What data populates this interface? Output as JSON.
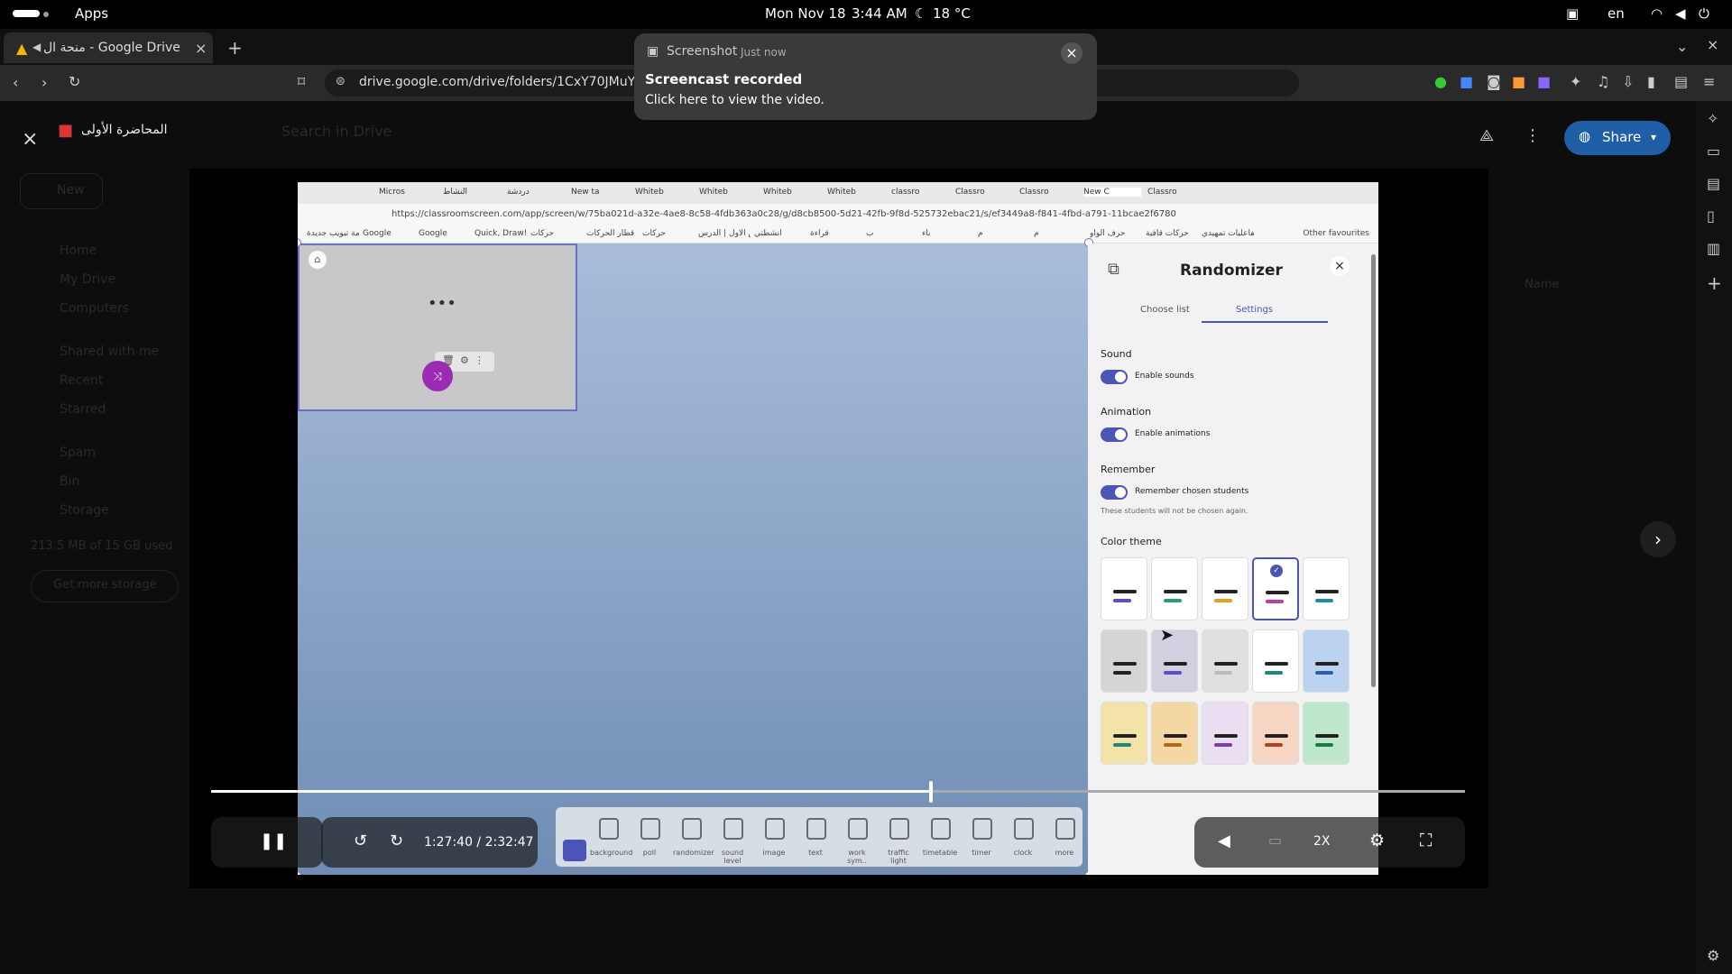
{
  "system_bar": {
    "activities": "Apps",
    "date": "Mon Nov 18",
    "time": "3:44 AM",
    "weather": "18 °C",
    "lang": "en"
  },
  "browser": {
    "tab_title": "منحة ال - Google Drive",
    "url": "drive.google.com/drive/folders/1CxY70JMuYZSLl"
  },
  "notification": {
    "app": "Screenshot",
    "when": "Just now",
    "title": "Screencast recorded",
    "body": "Click here to view the video."
  },
  "drive": {
    "file_title": "المحاضرة الأولى",
    "search_placeholder": "Search in Drive",
    "share_label": "Share",
    "new_label": "New",
    "sidebar": [
      "Home",
      "My Drive",
      "Computers",
      "Shared with me",
      "Recent",
      "Starred",
      "Spam",
      "Bin",
      "Storage"
    ],
    "storage_text": "213.5 MB of 15 GB used",
    "get_storage": "Get more storage",
    "sort_label": "Name"
  },
  "video": {
    "time": "1:27:40 / 2:32:47",
    "progress": 0.573,
    "speed": "2X",
    "inner_browser": {
      "tabs": [
        "Micros",
        "النشاط",
        "دردشة",
        "New ta",
        "Whiteb",
        "Whiteb",
        "Whiteb",
        "Whiteb",
        "classro",
        "Classro",
        "Classro",
        "New C",
        "Classro"
      ],
      "url": "https://classroomscreen.com/app/screen/w/75ba021d-a32e-4ae8-8c58-4fdb363a0c28/g/d8cb8500-5d21-42fb-9f8d-525732ebac21/s/ef3449a8-f841-4fbd-a791-11bcae2f6780",
      "bookmarks": [
        "علامة تبويب جديدة",
        "Google",
        "Google",
        "Quick, Draw!",
        "حركات",
        "قطار الحركات",
        "حركات",
        "التمرين الأول | الدرس...",
        "أنشطتي",
        "قراءة",
        "ب",
        "باء",
        "م",
        "م",
        "حرف الواو",
        "حركات قافية",
        "تفاعليات تمهيدي"
      ],
      "other_favourites": "Other favourites"
    },
    "randomizer": {
      "title": "Randomizer",
      "tab_choose": "Choose list",
      "tab_settings": "Settings",
      "sound_heading": "Sound",
      "sound_toggle": "Enable sounds",
      "animation_heading": "Animation",
      "animation_toggle": "Enable animations",
      "remember_heading": "Remember",
      "remember_toggle": "Remember chosen students",
      "remember_note": "These students will not be chosen again.",
      "color_heading": "Color theme",
      "swatches": [
        [
          "#ffffff",
          "#5c4fc4"
        ],
        [
          "#ffffff",
          "#27a06a"
        ],
        [
          "#ffffff",
          "#e0a21c"
        ],
        [
          "#ffffff",
          "#c03bb3"
        ],
        [
          "#ffffff",
          "#1b8fa8"
        ],
        [
          "#d5d5d5",
          "#222222"
        ],
        [
          "#d0d0e0",
          "#5c4fc4"
        ],
        [
          "#e0e0e0",
          "#bbbbbb"
        ],
        [
          "#ffffff",
          "#1a8b7a"
        ],
        [
          "#bcd3f0",
          "#2b5db0"
        ],
        [
          "#f4e3a8",
          "#1a8b7a"
        ],
        [
          "#f4d7a3",
          "#b5661e"
        ],
        [
          "#eadff2",
          "#7a3fb0"
        ],
        [
          "#f6d6c3",
          "#b5421e"
        ],
        [
          "#bfe7cc",
          "#1c7c45"
        ]
      ],
      "selected_swatch": 3
    },
    "tools": [
      "background",
      "poll",
      "randomizer",
      "sound level",
      "image",
      "text",
      "work sym..",
      "traffic light",
      "timetable",
      "timer",
      "clock",
      "more"
    ]
  }
}
